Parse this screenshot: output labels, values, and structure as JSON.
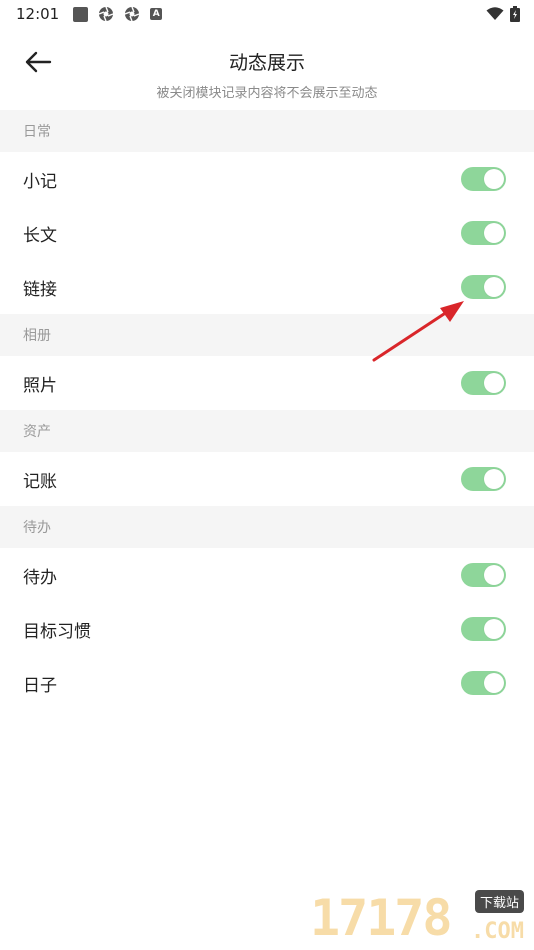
{
  "status_bar": {
    "time": "12:01",
    "icons": [
      "square-icon",
      "gear-icon",
      "gear-icon",
      "a-icon",
      "wifi-icon",
      "battery-icon"
    ]
  },
  "header": {
    "title": "动态展示",
    "subtitle": "被关闭模块记录内容将不会展示至动态"
  },
  "sections": [
    {
      "title": "日常",
      "items": [
        {
          "label": "小记",
          "enabled": true
        },
        {
          "label": "长文",
          "enabled": true
        },
        {
          "label": "链接",
          "enabled": true
        }
      ]
    },
    {
      "title": "相册",
      "items": [
        {
          "label": "照片",
          "enabled": true
        }
      ]
    },
    {
      "title": "资产",
      "items": [
        {
          "label": "记账",
          "enabled": true
        }
      ]
    },
    {
      "title": "待办",
      "items": [
        {
          "label": "待办",
          "enabled": true
        },
        {
          "label": "目标习惯",
          "enabled": true
        },
        {
          "label": "日子",
          "enabled": true
        }
      ]
    }
  ],
  "colors": {
    "toggle_on": "#8ed69a",
    "section_bg": "#f5f5f5",
    "annotation_arrow": "#d9262a"
  },
  "watermark": {
    "digits": "17178",
    "badge": "下载站",
    "suffix": ".COM"
  }
}
